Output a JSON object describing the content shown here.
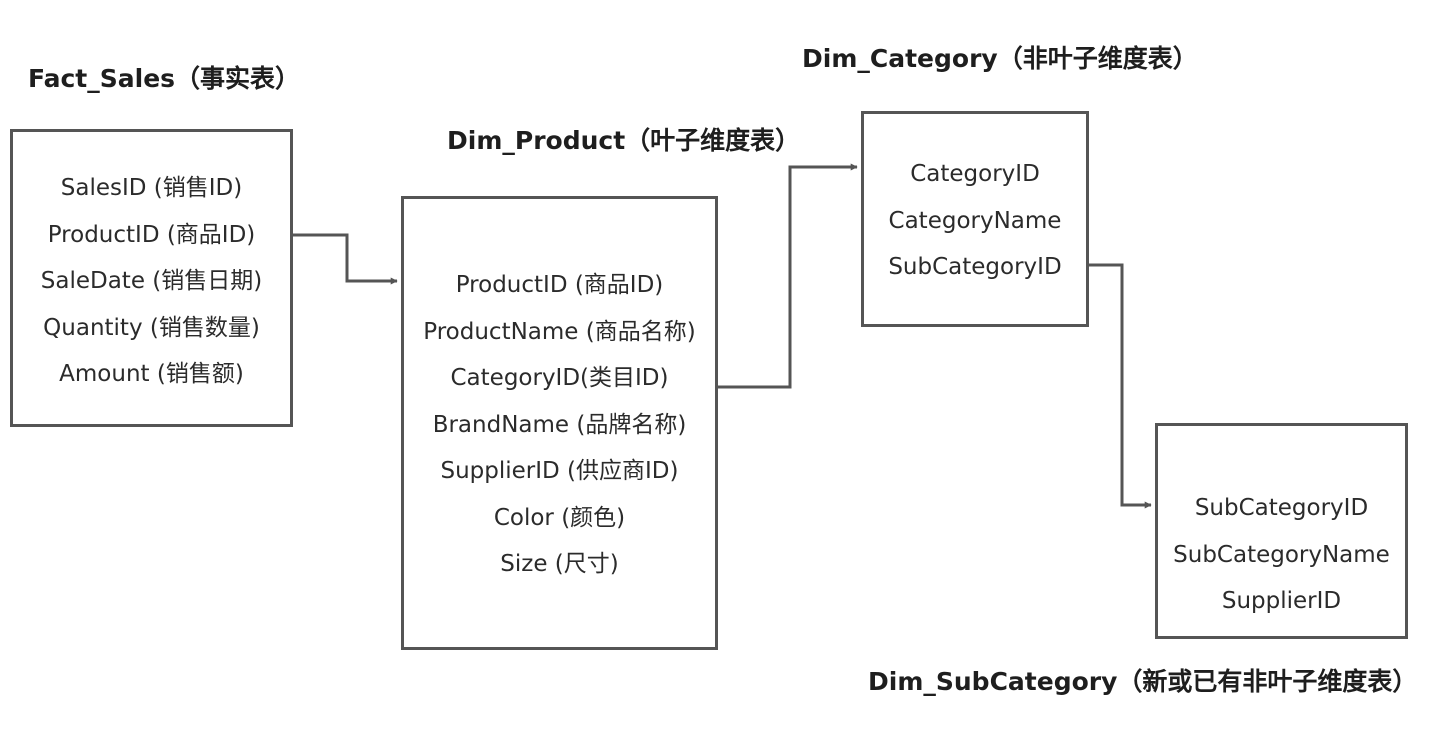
{
  "tables": {
    "fact_sales": {
      "title": "Fact_Sales（事实表）",
      "fields": [
        "SalesID (销售ID)",
        "ProductID (商品ID)",
        "SaleDate (销售日期)",
        "Quantity (销售数量)",
        "Amount (销售额)"
      ]
    },
    "dim_product": {
      "title": "Dim_Product（叶子维度表）",
      "fields": [
        "ProductID (商品ID)",
        "ProductName (商品名称)",
        "CategoryID(类目ID)",
        "BrandName (品牌名称)",
        "SupplierID (供应商ID)",
        "Color (颜色)",
        "Size (尺寸)"
      ]
    },
    "dim_category": {
      "title": "Dim_Category（非叶子维度表）",
      "fields": [
        "CategoryID",
        "CategoryName",
        "SubCategoryID"
      ]
    },
    "dim_subcategory": {
      "title": "Dim_SubCategory（新或已有非叶子维度表）",
      "fields": [
        "SubCategoryID",
        "SubCategoryName",
        "SupplierID"
      ]
    }
  },
  "colors": {
    "border": "#555555",
    "connector": "#555555",
    "title_text": "#1e1e1e",
    "field_text": "#2b2b2b"
  }
}
